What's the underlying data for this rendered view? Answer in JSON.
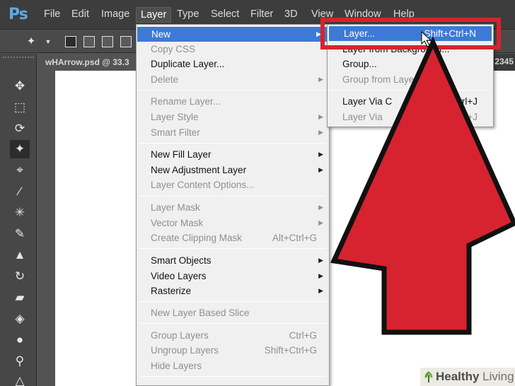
{
  "app": {
    "logo": "Ps"
  },
  "menubar": {
    "items": [
      "File",
      "Edit",
      "Image",
      "Layer",
      "Type",
      "Select",
      "Filter",
      "3D",
      "View",
      "Window",
      "Help"
    ]
  },
  "document_tab": {
    "title": "wHArrow.psd @ 33.3",
    "right_text": "2345"
  },
  "layer_menu": {
    "new": "New",
    "copy_css": "Copy CSS",
    "duplicate_layer": "Duplicate Layer...",
    "delete": "Delete",
    "rename_layer": "Rename Layer...",
    "layer_style": "Layer Style",
    "smart_filter": "Smart Filter",
    "new_fill_layer": "New Fill Layer",
    "new_adjustment_layer": "New Adjustment Layer",
    "layer_content_options": "Layer Content Options...",
    "layer_mask": "Layer Mask",
    "vector_mask": "Vector Mask",
    "create_clipping_mask": "Create Clipping Mask",
    "create_clipping_mask_shortcut": "Alt+Ctrl+G",
    "smart_objects": "Smart Objects",
    "video_layers": "Video Layers",
    "rasterize": "Rasterize",
    "new_layer_based_slice": "New Layer Based Slice",
    "group_layers": "Group Layers",
    "group_layers_shortcut": "Ctrl+G",
    "ungroup_layers": "Ungroup Layers",
    "ungroup_layers_shortcut": "Shift+Ctrl+G",
    "hide_layers": "Hide Layers"
  },
  "new_submenu": {
    "layer": "Layer...",
    "layer_shortcut": "Shift+Ctrl+N",
    "layer_from_background": "Layer from Background...",
    "group": "Group...",
    "group_from_layers": "Group from Layers...",
    "layer_via_copy": "Layer Via C",
    "layer_via_copy_shortcut": "Ctrl+J",
    "layer_via_cut": "Layer Via",
    "layer_via_cut_shortcut": "Shift+Ctrl+J"
  },
  "watermark": {
    "bold": "Healthy",
    "rest": " Living"
  },
  "colors": {
    "highlight": "#3d7ad6",
    "annotation_red": "#d6232f",
    "menubar": "#3d3d3d",
    "ps_blue": "#61a8e7"
  },
  "icons": {
    "toolbar": [
      "magic-wand-icon",
      "new-selection-icon",
      "add-selection-icon",
      "subtract-selection-icon",
      "intersect-selection-icon"
    ],
    "tools": [
      "move-tool-icon",
      "marquee-tool-icon",
      "lasso-tool-icon",
      "magic-wand-tool-icon",
      "crop-tool-icon",
      "eyedropper-tool-icon",
      "healing-brush-icon",
      "brush-tool-icon",
      "clone-stamp-icon",
      "history-brush-icon",
      "eraser-tool-icon",
      "paint-bucket-icon",
      "blur-tool-icon",
      "dodge-tool-icon",
      "pen-tool-icon"
    ]
  }
}
